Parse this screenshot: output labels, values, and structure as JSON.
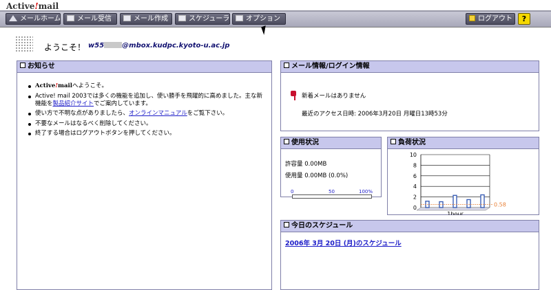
{
  "app": {
    "logo": "Active!mail",
    "logo_prefix": "Active",
    "logo_bang": "!",
    "logo_suffix": "mail"
  },
  "toolbar": {
    "buttons": [
      {
        "label": "メールホーム",
        "icon": "home-icon"
      },
      {
        "label": "メール受信",
        "icon": "envelope-icon"
      },
      {
        "label": "メール作成",
        "icon": "compose-icon"
      },
      {
        "label": "スケジューラ",
        "icon": "calendar-icon"
      },
      {
        "label": "オプション",
        "icon": "options-icon"
      }
    ],
    "logout_label": "ログアウト",
    "help_label": "?"
  },
  "user": {
    "greeting": "ようこそ！",
    "email_local": "w55",
    "email_domain": "@mbox.kudpc.kyoto-u.ac.jp"
  },
  "news": {
    "title": "お知らせ",
    "items": [
      {
        "brand_prefix": "Active",
        "brand_bang": "!",
        "brand_suffix": "mail",
        "text": "へようこそ。"
      },
      {
        "text": "Active! mail 2003では多くの機能を追加し、使い勝手を飛躍的に高めました。主な新機能を",
        "link": "製品紹介サイト",
        "after": "でご案内しています。"
      },
      {
        "text": "使い方で不明な点がありましたら、",
        "link": "オンラインマニュアル",
        "after": "をご覧下さい。"
      },
      {
        "text": "不要なメールはなるべく削除してください。"
      },
      {
        "text": "終了する場合はログアウトボタンを押してください。"
      }
    ]
  },
  "mail_info": {
    "title": "メール情報/ログイン情報",
    "new_mail": "新着メールはありません",
    "last_access": "最近のアクセス日時: 2006年3月20日 月曜日13時53分"
  },
  "usage": {
    "title": "使用状況",
    "quota": "許容量 0.00MB",
    "used": "使用量 0.00MB (0.0%)",
    "scale": [
      "0",
      "50",
      "100%"
    ],
    "fill_fraction": 0.0
  },
  "load": {
    "title": "負荷状況",
    "chart_data": {
      "type": "bar",
      "y_ticks": [
        "10",
        "8",
        "6",
        "4",
        "2",
        "0"
      ],
      "ylim": [
        0,
        10
      ],
      "values": [
        1.2,
        1.1,
        2.3,
        1.5,
        2.4
      ],
      "threshold": 0.58,
      "threshold_label": "0.58",
      "xlabel": "1hour",
      "bar_color": "#3b5fb6",
      "threshold_color": "#e8823a"
    }
  },
  "schedule": {
    "title": "今日のスケジュール",
    "link": "2006年 3月 20日 (月)のスケジュール"
  }
}
